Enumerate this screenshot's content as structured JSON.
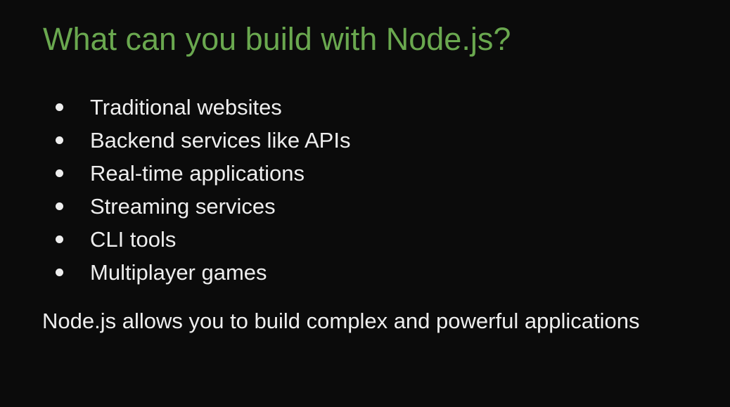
{
  "slide": {
    "title": "What can you build with Node.js?",
    "bullets": [
      "Traditional websites",
      "Backend services like APIs",
      "Real-time applications",
      "Streaming services",
      "CLI tools",
      "Multiplayer games"
    ],
    "summary": "Node.js allows you to build complex and powerful applications"
  },
  "colors": {
    "background": "#0b0b0b",
    "title": "#6aa84f",
    "text": "#eeeeee"
  }
}
